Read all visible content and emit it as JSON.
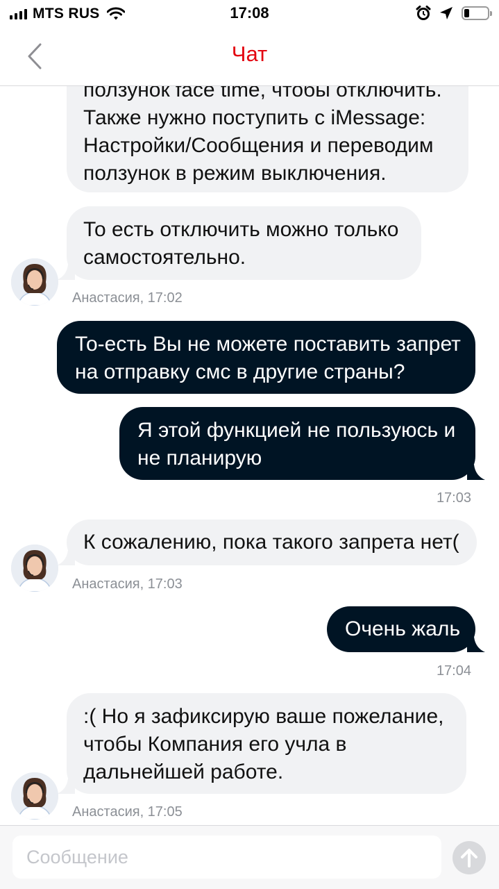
{
  "status_bar": {
    "carrier": "MTS RUS",
    "time": "17:08",
    "icons": [
      "signal-icon",
      "wifi-icon",
      "alarm-icon",
      "location-icon",
      "battery-icon"
    ]
  },
  "header": {
    "title": "Чат",
    "back_icon": "chevron-left-icon"
  },
  "colors": {
    "accent": "#e30611",
    "outgoing_bubble": "#001424",
    "incoming_bubble": "#f1f2f4",
    "meta_text": "#8b8f95"
  },
  "messages": [
    {
      "direction": "incoming",
      "lines": [
        "ползунок face time, чтобы отключить.",
        "Также нужно поступить с iMessage:",
        "Настройки/Сообщения и переводим",
        "ползунок в режим выключения."
      ]
    },
    {
      "direction": "incoming",
      "lines": [
        "То есть отключить можно только",
        "самостоятельно."
      ],
      "meta": "Анастасия, 17:02"
    },
    {
      "direction": "outgoing",
      "lines": [
        "То-есть Вы не можете поставить запрет",
        "на отправку смс в другие страны?"
      ]
    },
    {
      "direction": "outgoing",
      "lines": [
        "Я этой функцией не пользуюсь и",
        "не планирую"
      ],
      "meta": "17:03"
    },
    {
      "direction": "incoming",
      "lines": [
        "К сожалению, пока такого запрета нет("
      ],
      "meta": "Анастасия, 17:03"
    },
    {
      "direction": "outgoing",
      "lines": [
        "Очень жаль"
      ],
      "meta": "17:04"
    },
    {
      "direction": "incoming",
      "lines": [
        ":( Но я зафиксирую ваше пожелание,",
        "чтобы Компания его учла в",
        "дальнейшей работе."
      ],
      "meta": "Анастасия, 17:05"
    }
  ],
  "composer": {
    "placeholder": "Сообщение",
    "value": "",
    "send_icon": "arrow-up-icon"
  }
}
